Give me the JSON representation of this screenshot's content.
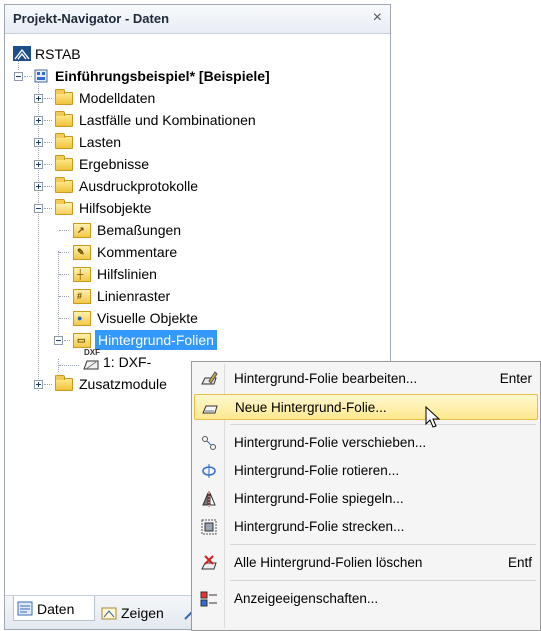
{
  "panel": {
    "title": "Projekt-Navigator - Daten",
    "close_symbol": "×"
  },
  "tree": {
    "root": "RSTAB",
    "project": "Einführungsbeispiel* [Beispiele]",
    "top_folders": [
      "Modelldaten",
      "Lastfälle und Kombinationen",
      "Lasten",
      "Ergebnisse",
      "Ausdruckprotokolle"
    ],
    "hilfsobjekte": "Hilfsobjekte",
    "hilfs_children": [
      "Bemaßungen",
      "Kommentare",
      "Hilfslinien",
      "Linienraster",
      "Visuelle Objekte"
    ],
    "hintergrund": "Hintergrund-Folien",
    "dxf_item": "1: DXF-",
    "dxf_badge": "DXF",
    "zusatz": "Zusatzmodule"
  },
  "bottom_tabs": {
    "daten": "Daten",
    "zeigen": "Zeigen"
  },
  "context_menu": {
    "items": [
      {
        "label": "Hintergrund-Folie bearbeiten...",
        "shortcut": "Enter",
        "icon": "edit-background-icon"
      },
      {
        "label": "Neue Hintergrund-Folie...",
        "shortcut": "",
        "icon": "new-background-icon"
      },
      {
        "label": "Hintergrund-Folie verschieben...",
        "shortcut": "",
        "icon": "move-icon"
      },
      {
        "label": "Hintergrund-Folie rotieren...",
        "shortcut": "",
        "icon": "rotate-icon"
      },
      {
        "label": "Hintergrund-Folie spiegeln...",
        "shortcut": "",
        "icon": "mirror-icon"
      },
      {
        "label": "Hintergrund-Folie strecken...",
        "shortcut": "",
        "icon": "stretch-icon"
      },
      {
        "label": "Alle Hintergrund-Folien löschen",
        "shortcut": "Entf",
        "icon": "delete-all-icon"
      },
      {
        "label": "Anzeigeeigenschaften...",
        "shortcut": "",
        "icon": "display-properties-icon"
      }
    ],
    "highlighted_index": 1
  },
  "colors": {
    "selection": "#3399ff",
    "menu_highlight": "#fde88e"
  }
}
